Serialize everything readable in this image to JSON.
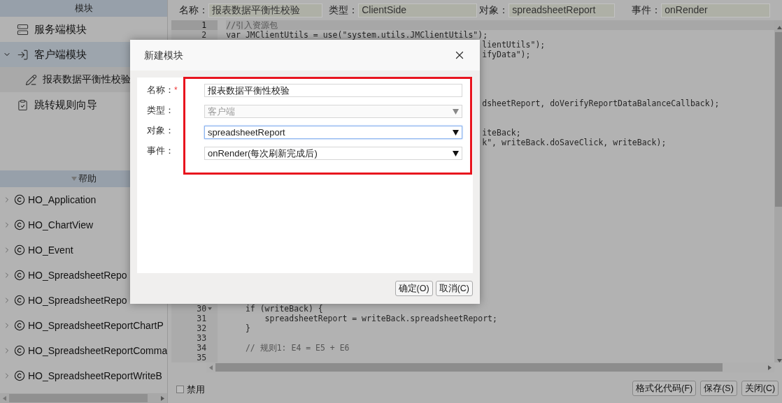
{
  "sidebar": {
    "modules_header": "模块",
    "modules": [
      {
        "label": "服务端模块",
        "kind": "server",
        "selected": false
      },
      {
        "label": "客户端模块",
        "kind": "client",
        "selected": true,
        "expanded": true,
        "children": [
          {
            "label": "报表数据平衡性校验",
            "kind": "script",
            "selected": false
          }
        ]
      },
      {
        "label": "跳转规则向导",
        "kind": "wizard",
        "selected": false
      }
    ],
    "help_header": "帮助",
    "help_items": [
      {
        "label": "HO_Application",
        "expanded": false
      },
      {
        "label": "HO_ChartView",
        "expanded": false
      },
      {
        "label": "HO_Event",
        "expanded": false
      },
      {
        "label": "HO_SpreadsheetRepo",
        "expanded": false
      },
      {
        "label": "HO_SpreadsheetRepo",
        "expanded": false
      },
      {
        "label": "HO_SpreadsheetReportChartP",
        "expanded": false
      },
      {
        "label": "HO_SpreadsheetReportComma",
        "expanded": false
      },
      {
        "label": "HO_SpreadsheetReportWriteB",
        "expanded": false
      }
    ]
  },
  "header_fields": [
    {
      "label": "名称：",
      "value": "报表数据平衡性校验"
    },
    {
      "label": "类型：",
      "value": "ClientSide"
    },
    {
      "label": "对象：",
      "value": "spreadsheetReport"
    },
    {
      "label": "事件：",
      "value": "onRender"
    }
  ],
  "editor": {
    "lines": [
      {
        "kind": "line",
        "number": "1",
        "text": "//引入资源包",
        "comment": true,
        "current": true
      },
      {
        "kind": "line",
        "number": "2",
        "text": "var JMClientUtils = use(\"system.utils.JMClientUtils\");",
        "comment": false,
        "current": false
      },
      {
        "kind": "hidden",
        "text": "lientUtils\");"
      },
      {
        "kind": "hidden",
        "text": "ifyData\");"
      },
      {
        "kind": "hidden"
      },
      {
        "kind": "hidden"
      },
      {
        "kind": "hidden"
      },
      {
        "kind": "hidden"
      },
      {
        "kind": "hidden",
        "text": "dsheetReport, doVerifyReportDataBalanceCallback);"
      },
      {
        "kind": "hidden"
      },
      {
        "kind": "hidden"
      },
      {
        "kind": "hidden",
        "text": "iteBack;"
      },
      {
        "kind": "hidden",
        "text": "k\", writeBack.doSaveClick, writeBack);"
      },
      {
        "kind": "hidden"
      },
      {
        "kind": "hidden"
      },
      {
        "kind": "hidden"
      },
      {
        "kind": "hidden"
      },
      {
        "kind": "hidden"
      },
      {
        "kind": "hidden"
      },
      {
        "kind": "hidden"
      },
      {
        "kind": "hidden"
      },
      {
        "kind": "hidden"
      },
      {
        "kind": "hidden"
      },
      {
        "kind": "hidden"
      },
      {
        "kind": "hidden"
      },
      {
        "kind": "hidden"
      },
      {
        "kind": "hidden"
      },
      {
        "kind": "hidden"
      },
      {
        "kind": "hidden"
      },
      {
        "kind": "line",
        "number": "30",
        "text": "    if (writeBack) {",
        "comment": false,
        "current": false,
        "foldable": true
      },
      {
        "kind": "line",
        "number": "31",
        "text": "        spreadsheetReport = writeBack.spreadsheetReport;",
        "comment": false,
        "current": false
      },
      {
        "kind": "line",
        "number": "32",
        "text": "    }",
        "comment": false,
        "current": false
      },
      {
        "kind": "line",
        "number": "33",
        "current": false
      },
      {
        "kind": "line",
        "number": "34",
        "text": "    // 规则1: E4 = E5 + E6",
        "comment": true,
        "current": false
      },
      {
        "kind": "line",
        "number": "35",
        "current": false
      }
    ]
  },
  "footer": {
    "disable_checkbox": {
      "label": "禁用",
      "checked": false
    },
    "buttons": [
      "格式化代码(F)",
      "保存(S)",
      "关闭(C)"
    ]
  },
  "dialog": {
    "title": "新建模块",
    "required_mark": "*",
    "fields": [
      {
        "label": "名称：",
        "required": true,
        "kind": "input",
        "value": "报表数据平衡性校验",
        "disabled": false,
        "focused": false
      },
      {
        "label": "类型：",
        "required": false,
        "kind": "select",
        "value": "客户端",
        "disabled": true,
        "focused": false
      },
      {
        "label": "对象：",
        "required": false,
        "kind": "select",
        "value": "spreadsheetReport",
        "disabled": false,
        "focused": true
      },
      {
        "label": "事件：",
        "required": false,
        "kind": "select",
        "value": "onRender(每次刷新完成后)",
        "disabled": false,
        "focused": false
      }
    ],
    "buttons": [
      "确定(O)",
      "取消(C)"
    ]
  }
}
